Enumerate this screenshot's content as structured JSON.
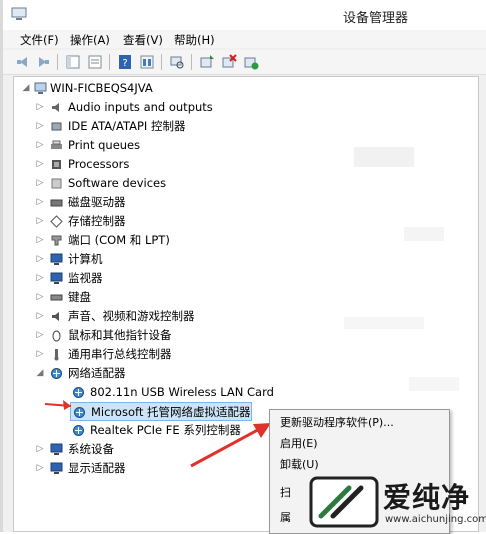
{
  "window": {
    "title": "设备管理器"
  },
  "menu": [
    "文件(F)",
    "操作(A)",
    "查看(V)",
    "帮助(H)"
  ],
  "tree": {
    "root": "WIN-FICBEQS4JVA",
    "categories": [
      {
        "label": "Audio inputs and outputs",
        "icon": "speaker-icon"
      },
      {
        "label": "IDE ATA/ATAPI 控制器",
        "icon": "ide-controller-icon"
      },
      {
        "label": "Print queues",
        "icon": "printer-icon"
      },
      {
        "label": "Processors",
        "icon": "processor-icon"
      },
      {
        "label": "Software devices",
        "icon": "software-device-icon"
      },
      {
        "label": "磁盘驱动器",
        "icon": "disk-drive-icon"
      },
      {
        "label": "存储控制器",
        "icon": "storage-controller-icon"
      },
      {
        "label": "端口 (COM 和 LPT)",
        "icon": "port-icon"
      },
      {
        "label": "计算机",
        "icon": "computer-icon"
      },
      {
        "label": "监视器",
        "icon": "monitor-icon"
      },
      {
        "label": "键盘",
        "icon": "keyboard-icon"
      },
      {
        "label": "声音、视频和游戏控制器",
        "icon": "sound-video-icon"
      },
      {
        "label": "鼠标和其他指针设备",
        "icon": "mouse-icon"
      },
      {
        "label": "通用串行总线控制器",
        "icon": "usb-icon"
      },
      {
        "label": "网络适配器",
        "icon": "network-adapter-icon"
      }
    ],
    "network_children": [
      "802.11n USB Wireless LAN Card",
      "Microsoft 托管网络虚拟适配器",
      "Realtek PCIe FE 系列控制器"
    ],
    "after": [
      {
        "label": "系统设备",
        "icon": "system-device-icon"
      },
      {
        "label": "显示适配器",
        "icon": "display-adapter-icon"
      }
    ]
  },
  "context_menu": [
    "更新驱动程序软件(P)...",
    "启用(E)",
    "卸载(U)",
    "扫",
    "属"
  ],
  "brand": {
    "name": "爱纯净",
    "url": "www.aichunjing.com"
  },
  "colors": {
    "selection": "#cde4f7",
    "arrow": "#e0322a",
    "accent": "#2c7a3f"
  }
}
